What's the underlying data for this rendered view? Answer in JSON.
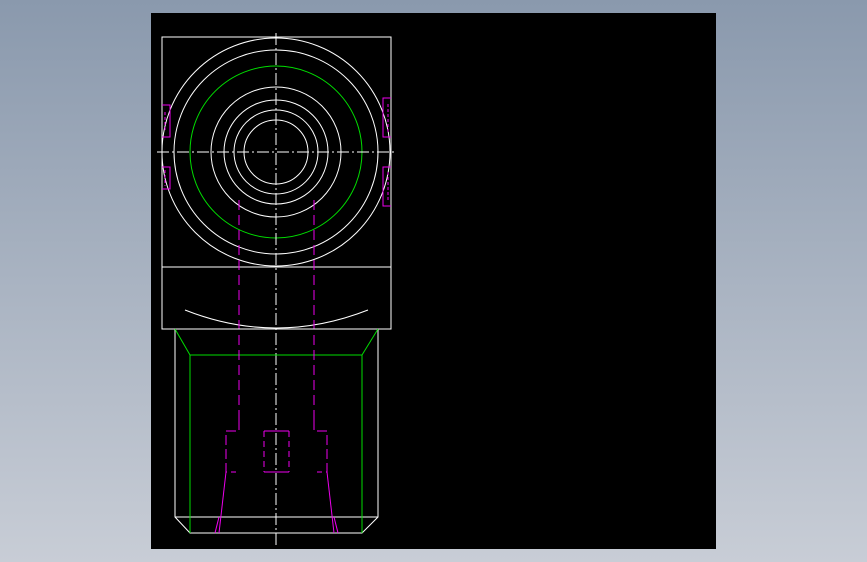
{
  "background": {
    "gradient_top": "#8a99ad",
    "gradient_bottom": "#c8cdd6"
  },
  "viewport": {
    "background_color": "#000000"
  },
  "drawing": {
    "line_colors": {
      "outline": "#ffffff",
      "thread": "#00dd00",
      "hidden": "#ee00ee",
      "centerline": "#ffffff"
    },
    "views": [
      "top-view",
      "front-view"
    ]
  }
}
